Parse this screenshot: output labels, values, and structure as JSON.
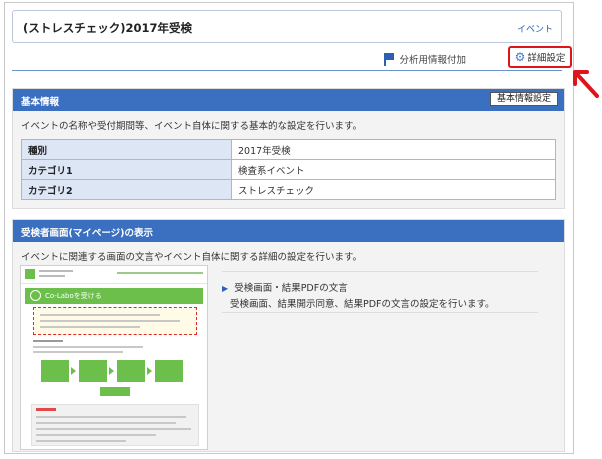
{
  "header": {
    "title": "(ストレスチェック)2017年受検",
    "tag": "イベント"
  },
  "toolbar": {
    "analysis_label": "分析用情報付加",
    "settings_label": "詳細設定",
    "analysis_icon": "flag-icon",
    "settings_icon": "gear-icon",
    "highlight_color": "#e0141b"
  },
  "basic": {
    "heading": "基本情報",
    "button_label": "基本情報設定",
    "description": "イベントの名称や受付期間等、イベント自体に関する基本的な設定を行います。",
    "rows": [
      {
        "key": "種別",
        "value": "2017年受検"
      },
      {
        "key": "カテゴリ1",
        "value": "検査系イベント"
      },
      {
        "key": "カテゴリ2",
        "value": "ストレスチェック"
      }
    ]
  },
  "mypage": {
    "heading": "受検者画面(マイページ)の表示",
    "description": "イベントに関連する画面の文言やイベント自体に関する詳細の設定を行います。",
    "preview_banner": "Co-Laboを受ける",
    "link_label": "受検画面・結果PDFの文言",
    "link_description": "受検画面、結果開示同意、結果PDFの文言の設定を行います。"
  },
  "colors": {
    "section_header": "#3b6fc0",
    "table_key_bg": "#dde6f5",
    "accent_green": "#6cbf4a"
  }
}
